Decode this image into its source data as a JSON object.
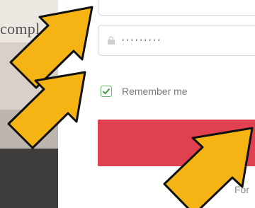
{
  "left_panel": {
    "text": "compl"
  },
  "form": {
    "password_value": "·········",
    "remember_label": "Remember me",
    "remember_checked": true,
    "submit_label": "",
    "forgot_link": "For"
  },
  "colors": {
    "accent": "#e04050",
    "checkbox": "#6ab86a",
    "arrow_fill": "#f5b414"
  },
  "icons": [
    "lock-icon",
    "check-icon",
    "pointer-arrow-icon"
  ]
}
